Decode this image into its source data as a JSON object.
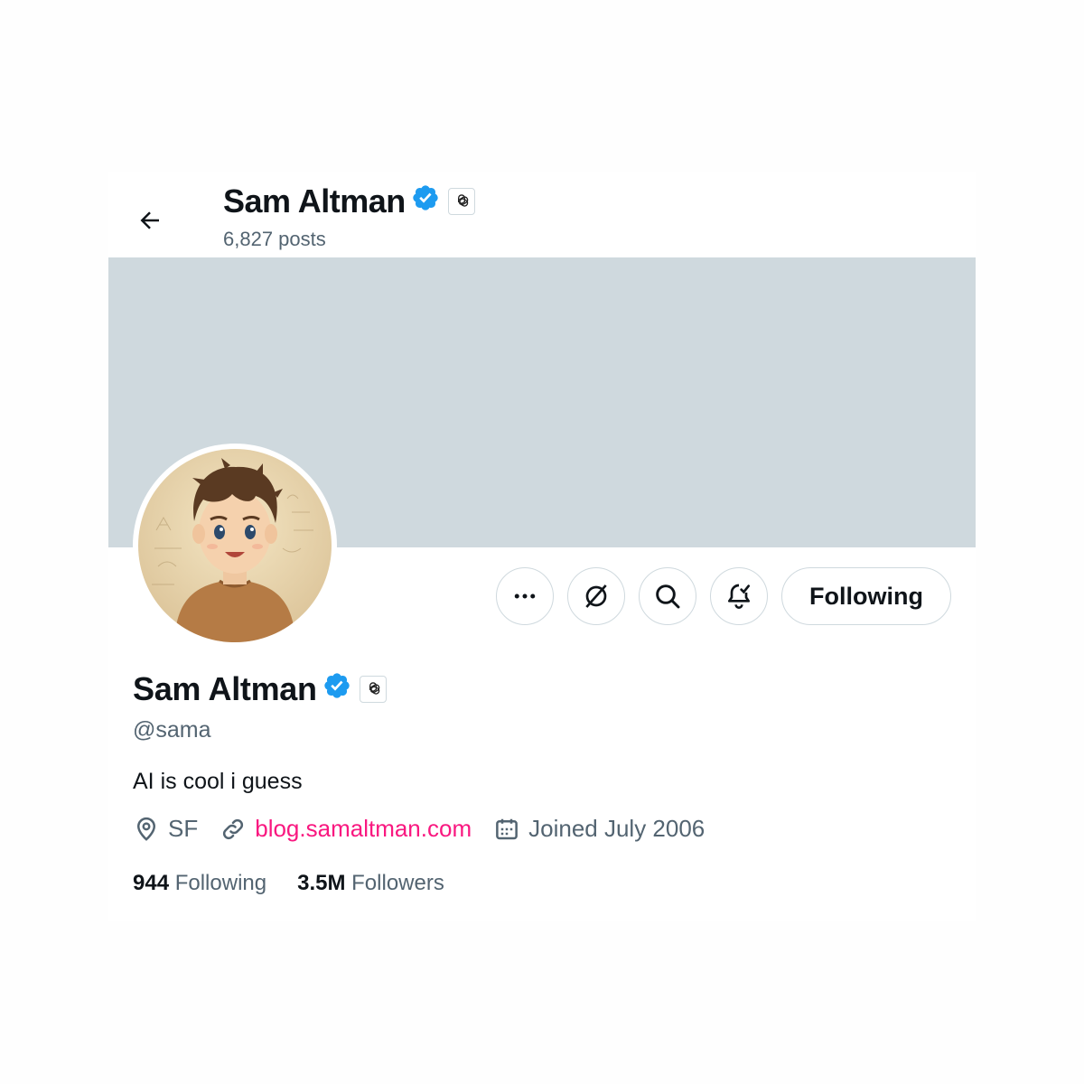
{
  "header": {
    "name": "Sam Altman",
    "posts": "6,827 posts"
  },
  "profile": {
    "name": "Sam Altman",
    "handle": "@sama",
    "bio": "AI is cool i guess",
    "location": "SF",
    "website": "blog.samaltman.com",
    "joined": "Joined July 2006"
  },
  "stats": {
    "following_count": "944",
    "following_label": "Following",
    "followers_count": "3.5M",
    "followers_label": "Followers"
  },
  "actions": {
    "follow_label": "Following",
    "buttons": [
      "more-icon",
      "grok-icon",
      "search-icon",
      "notification-bell-icon"
    ]
  },
  "colors": {
    "banner": "#cfd9de",
    "verified": "#1d9bf0",
    "link": "#f91880",
    "secondary_text": "#536471"
  }
}
